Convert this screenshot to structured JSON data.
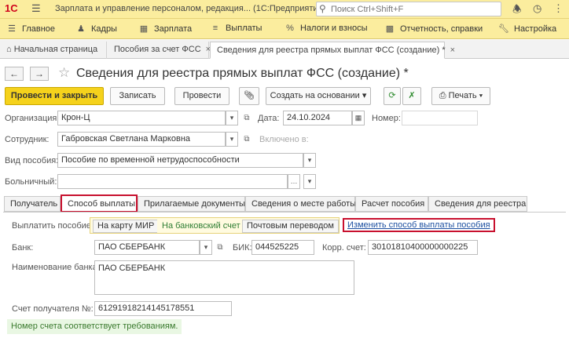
{
  "titlebar": {
    "logo": "1С",
    "title": "Зарплата и управление персоналом, редакция... (1С:Предприятие)",
    "search_placeholder": "Поиск Ctrl+Shift+F"
  },
  "menu": [
    {
      "label": "Главное",
      "icon": "menu-icon"
    },
    {
      "label": "Кадры",
      "icon": "people-icon"
    },
    {
      "label": "Зарплата",
      "icon": "calculator-icon"
    },
    {
      "label": "Выплаты",
      "icon": "list-icon"
    },
    {
      "label": "Налоги и взносы",
      "icon": "percent-icon"
    },
    {
      "label": "Отчетность, справки",
      "icon": "report-icon"
    },
    {
      "label": "Настройка",
      "icon": "wrench-icon"
    }
  ],
  "window_tabs": [
    {
      "label": "Начальная страница"
    },
    {
      "label": "Пособия за счет ФСС"
    },
    {
      "label": "Сведения для реестра прямых выплат ФСС (создание) *"
    }
  ],
  "form": {
    "title": "Сведения для реестра прямых выплат ФСС (создание) *",
    "toolbar": {
      "post_close": "Провести и закрыть",
      "save": "Записать",
      "post": "Провести",
      "create_based": "Создать на основании",
      "print": "Печать"
    },
    "organization_label": "Организация:",
    "organization_value": "Крон-Ц",
    "date_label": "Дата:",
    "date_value": "24.10.2024",
    "number_label": "Номер:",
    "number_value": "",
    "employee_label": "Сотрудник:",
    "employee_value": "Габровская Светлана Марковна",
    "included_label": "Включено в:",
    "benefit_label": "Вид пособия:",
    "benefit_value": "Пособие по временной нетрудоспособности",
    "sick_label": "Больничный:",
    "sick_value": ""
  },
  "inner_tabs": [
    {
      "label": "Получатель"
    },
    {
      "label": "Способ выплаты"
    },
    {
      "label": "Прилагаемые документы"
    },
    {
      "label": "Сведения о месте работы"
    },
    {
      "label": "Расчет пособия"
    },
    {
      "label": "Сведения для реестра"
    }
  ],
  "payment": {
    "label": "Выплатить пособие:",
    "options": [
      "На карту МИР",
      "На банковский счет",
      "Почтовым переводом"
    ],
    "selected": "На банковский счет",
    "change_link": "Изменить способ выплаты пособия",
    "bank_label": "Банк:",
    "bank_value": "ПАО СБЕРБАНК",
    "bik_label": "БИК:",
    "bik_value": "044525225",
    "corr_label": "Корр. счет:",
    "corr_value": "30101810400000000225",
    "bank_name_label": "Наименование банка:",
    "bank_name_value": "ПАО СБЕРБАНК",
    "account_label": "Счет получателя №:",
    "account_value": "61291918214145178551",
    "status_message": "Номер счета соответствует требованиям."
  }
}
